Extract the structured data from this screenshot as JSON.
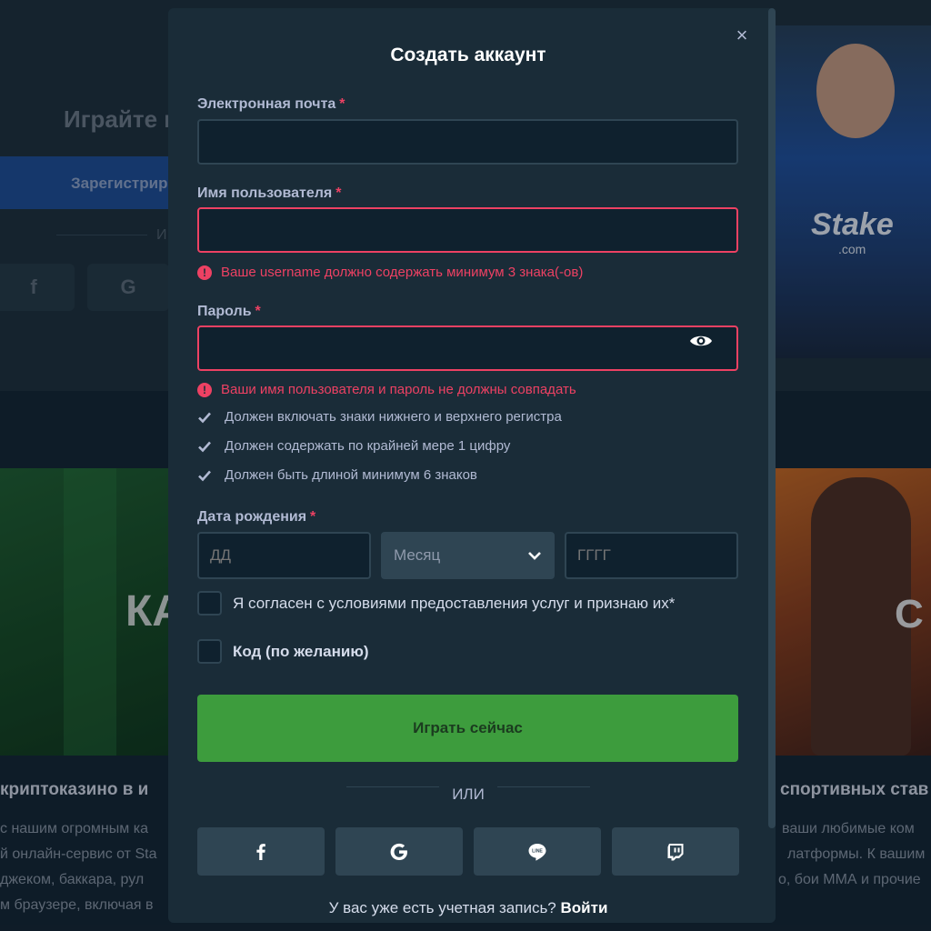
{
  "background": {
    "hero_title": "Играйте в",
    "register_button": "Зарегистрир",
    "or_partial": "И",
    "social": [
      "f",
      "G"
    ],
    "stake_logo": "Stake",
    "stake_sub": ".com",
    "casino_card_text": "КА",
    "sports_card_text": "С",
    "casino_heading": "криптоказино в и",
    "sports_heading": "спортивных став",
    "casino_lines": [
      "с нашим огромным ка",
      "й онлайн-сервис от Sta",
      "джеком, баккара, рул",
      "м браузере, включая в"
    ],
    "sports_lines": [
      "ваши любимые ком",
      "латформы. К вашим",
      "о, бои ММА и прочие"
    ]
  },
  "modal": {
    "title": "Создать аккаунт",
    "close_label": "×",
    "email_label": "Электронная почта",
    "username_label": "Имя пользователя",
    "username_error": "Ваше username должно содержать минимум 3 знака(-ов)",
    "password_label": "Пароль",
    "password_error": "Ваши имя пользователя и пароль не должны совпадать",
    "password_rules": [
      "Должен включать знаки нижнего и верхнего регистра",
      "Должен содержать по крайней мере 1 цифру",
      "Должен быть длиной минимум 6 знаков"
    ],
    "required_mark": "*",
    "error_icon": "!",
    "dob_label": "Дата рождения",
    "dob_day_placeholder": "ДД",
    "dob_month_value": "Месяц",
    "dob_year_placeholder": "ГГГГ",
    "terms_label": "Я согласен с условиями предоставления услуг и признаю их*",
    "code_label": "Код (по желанию)",
    "submit_label": "Играть сейчас",
    "or_label": "ИЛИ",
    "login_prompt": "У вас уже есть учетная запись?",
    "login_link": "Войти",
    "social_icons": [
      "facebook-icon",
      "google-icon",
      "line-icon",
      "twitch-icon"
    ]
  },
  "colors": {
    "accent_green": "#3d9c3d",
    "error_red": "#ed4163",
    "panel": "#1a2c38",
    "input_bg": "#0f212e"
  }
}
